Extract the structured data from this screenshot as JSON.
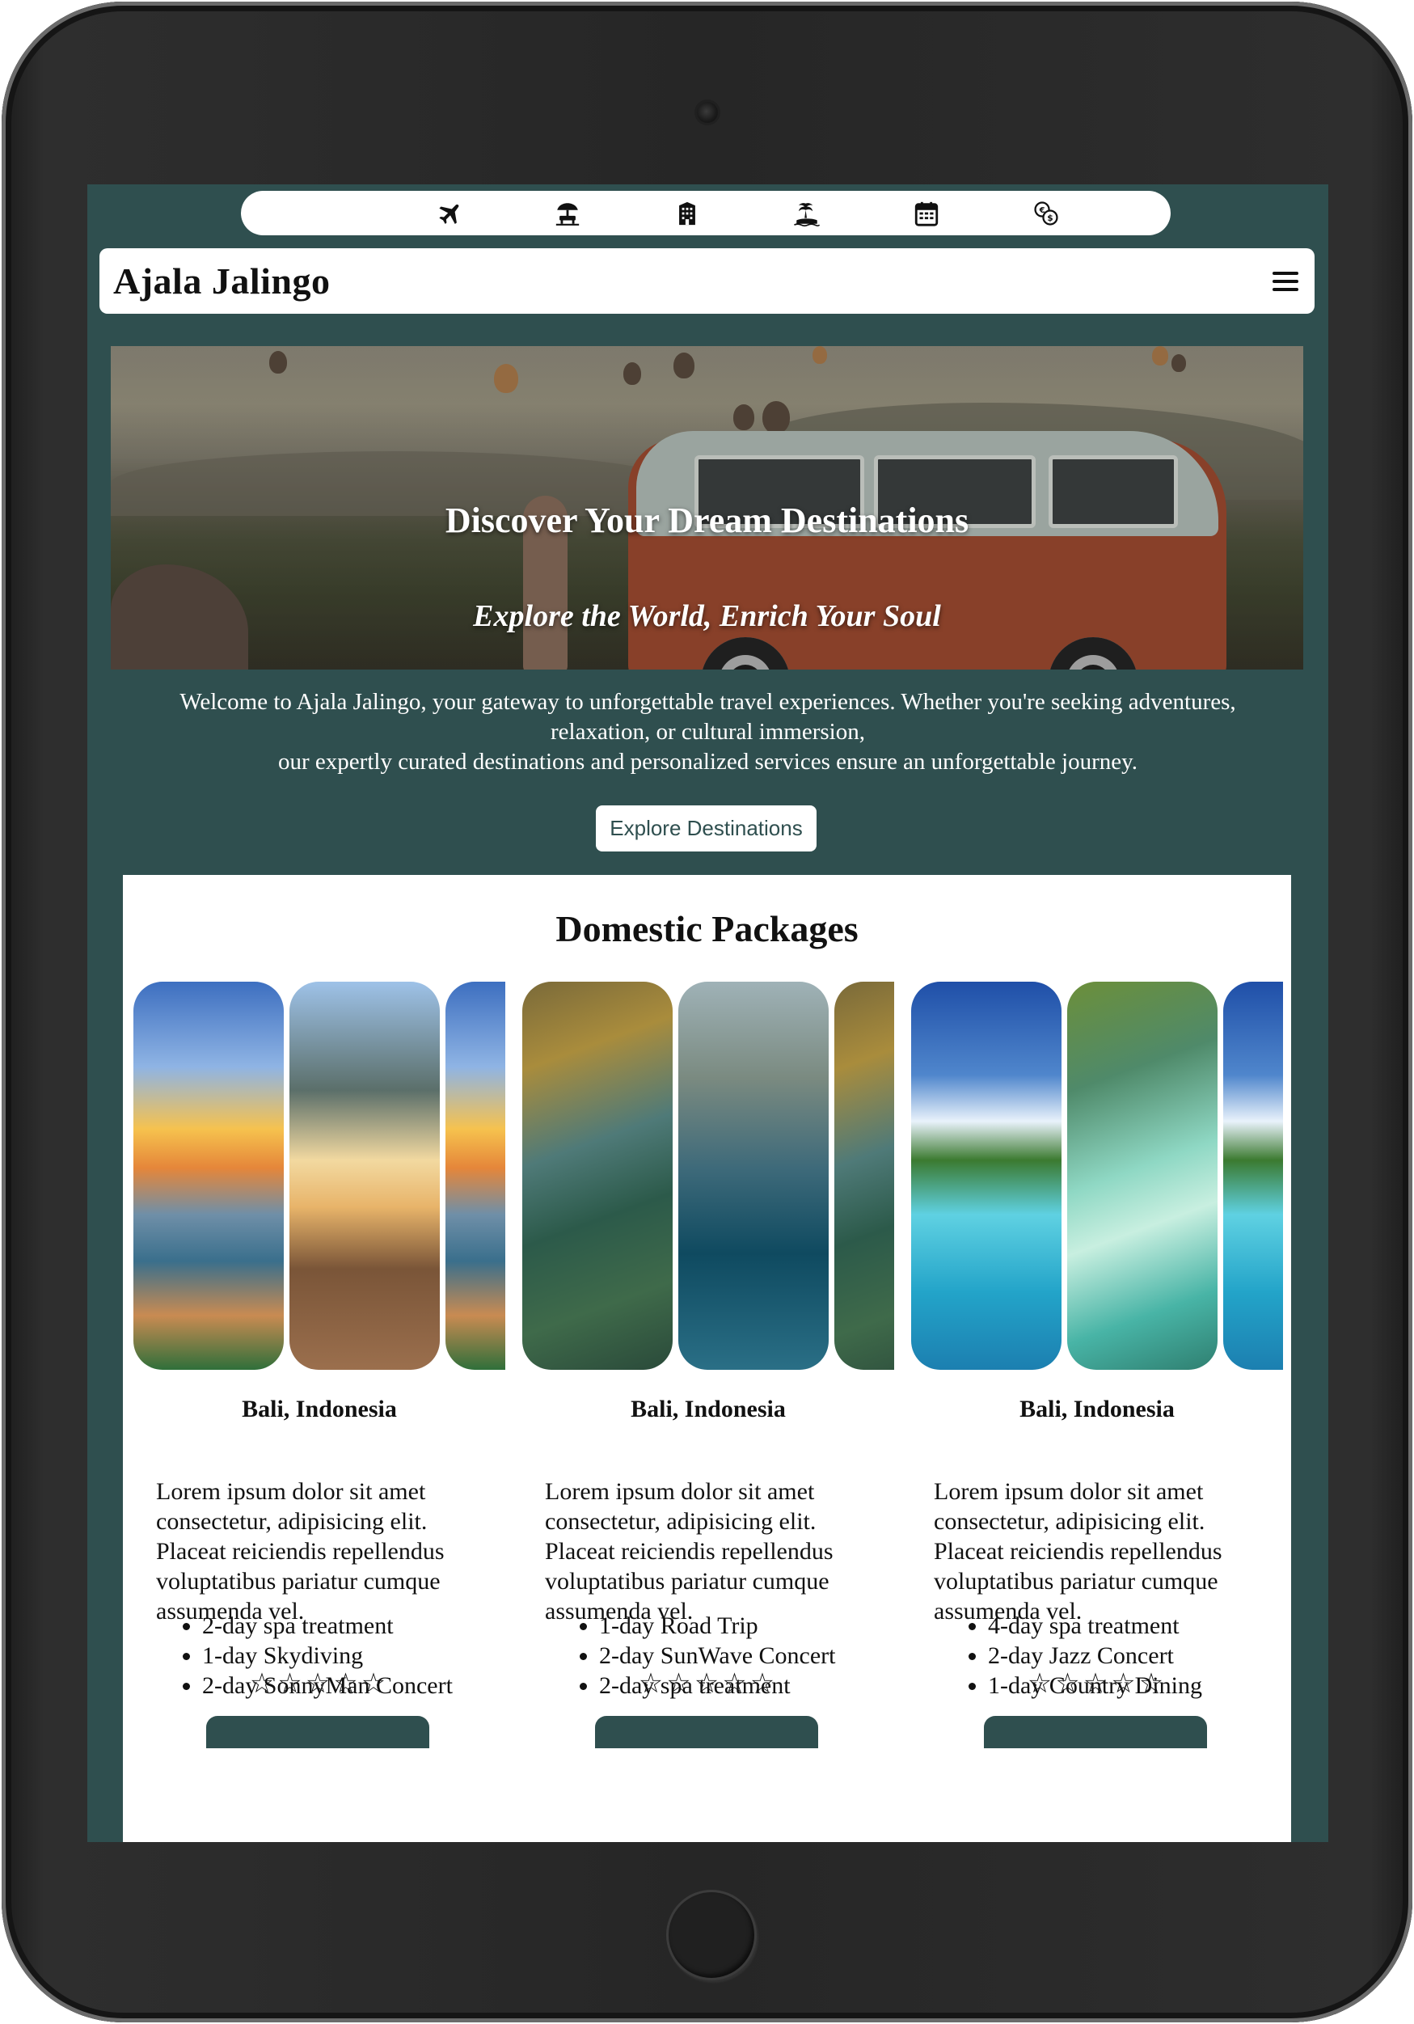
{
  "icon_bar": {
    "icons": [
      "airplane-icon",
      "beach-umbrella-icon",
      "hotel-building-icon",
      "island-icon",
      "calendar-icon",
      "currency-exchange-icon"
    ]
  },
  "navbar": {
    "brand": "Ajala Jalingo",
    "menu_icon": "hamburger-menu-icon"
  },
  "hero": {
    "title": "Discover Your Dream Destinations",
    "subtitle": "Explore the World, Enrich Your Soul"
  },
  "welcome": {
    "line1": "Welcome to Ajala Jalingo, your gateway to unforgettable travel experiences. Whether you're seeking adventures, relaxation, or cultural immersion,",
    "line2": "our expertly curated destinations and personalized services ensure an unforgettable journey.",
    "button_label": "Explore Destinations"
  },
  "packages": {
    "heading": "Domestic Packages",
    "cards": [
      {
        "location": "Bali, Indonesia",
        "description": "Lorem ipsum dolor sit amet consectetur, adipisicing elit. Placeat reiciendis repellendus voluptatibus pariatur cumque assumenda vel.",
        "features": [
          "2-day spa treatment",
          "1-day Skydiving",
          "2-day SonnyMan Concert"
        ],
        "rating": "☆☆☆☆☆"
      },
      {
        "location": "Bali, Indonesia",
        "description": "Lorem ipsum dolor sit amet consectetur, adipisicing elit. Placeat reiciendis repellendus voluptatibus pariatur cumque assumenda vel.",
        "features": [
          "1-day Road Trip",
          "2-day SunWave Concert",
          "2-day spa treatment"
        ],
        "rating": "☆☆☆☆☆"
      },
      {
        "location": "Bali, Indonesia",
        "description": "Lorem ipsum dolor sit amet consectetur, adipisicing elit. Placeat reiciendis repellendus voluptatibus pariatur cumque assumenda vel.",
        "features": [
          "4-day spa treatment",
          "2-day Jazz Concert",
          "1-day Country Dining"
        ],
        "rating": "☆☆☆☆☆"
      }
    ]
  },
  "colors": {
    "page_background": "#2f4f4f",
    "panel_background": "#ffffff",
    "text": "#111111"
  }
}
